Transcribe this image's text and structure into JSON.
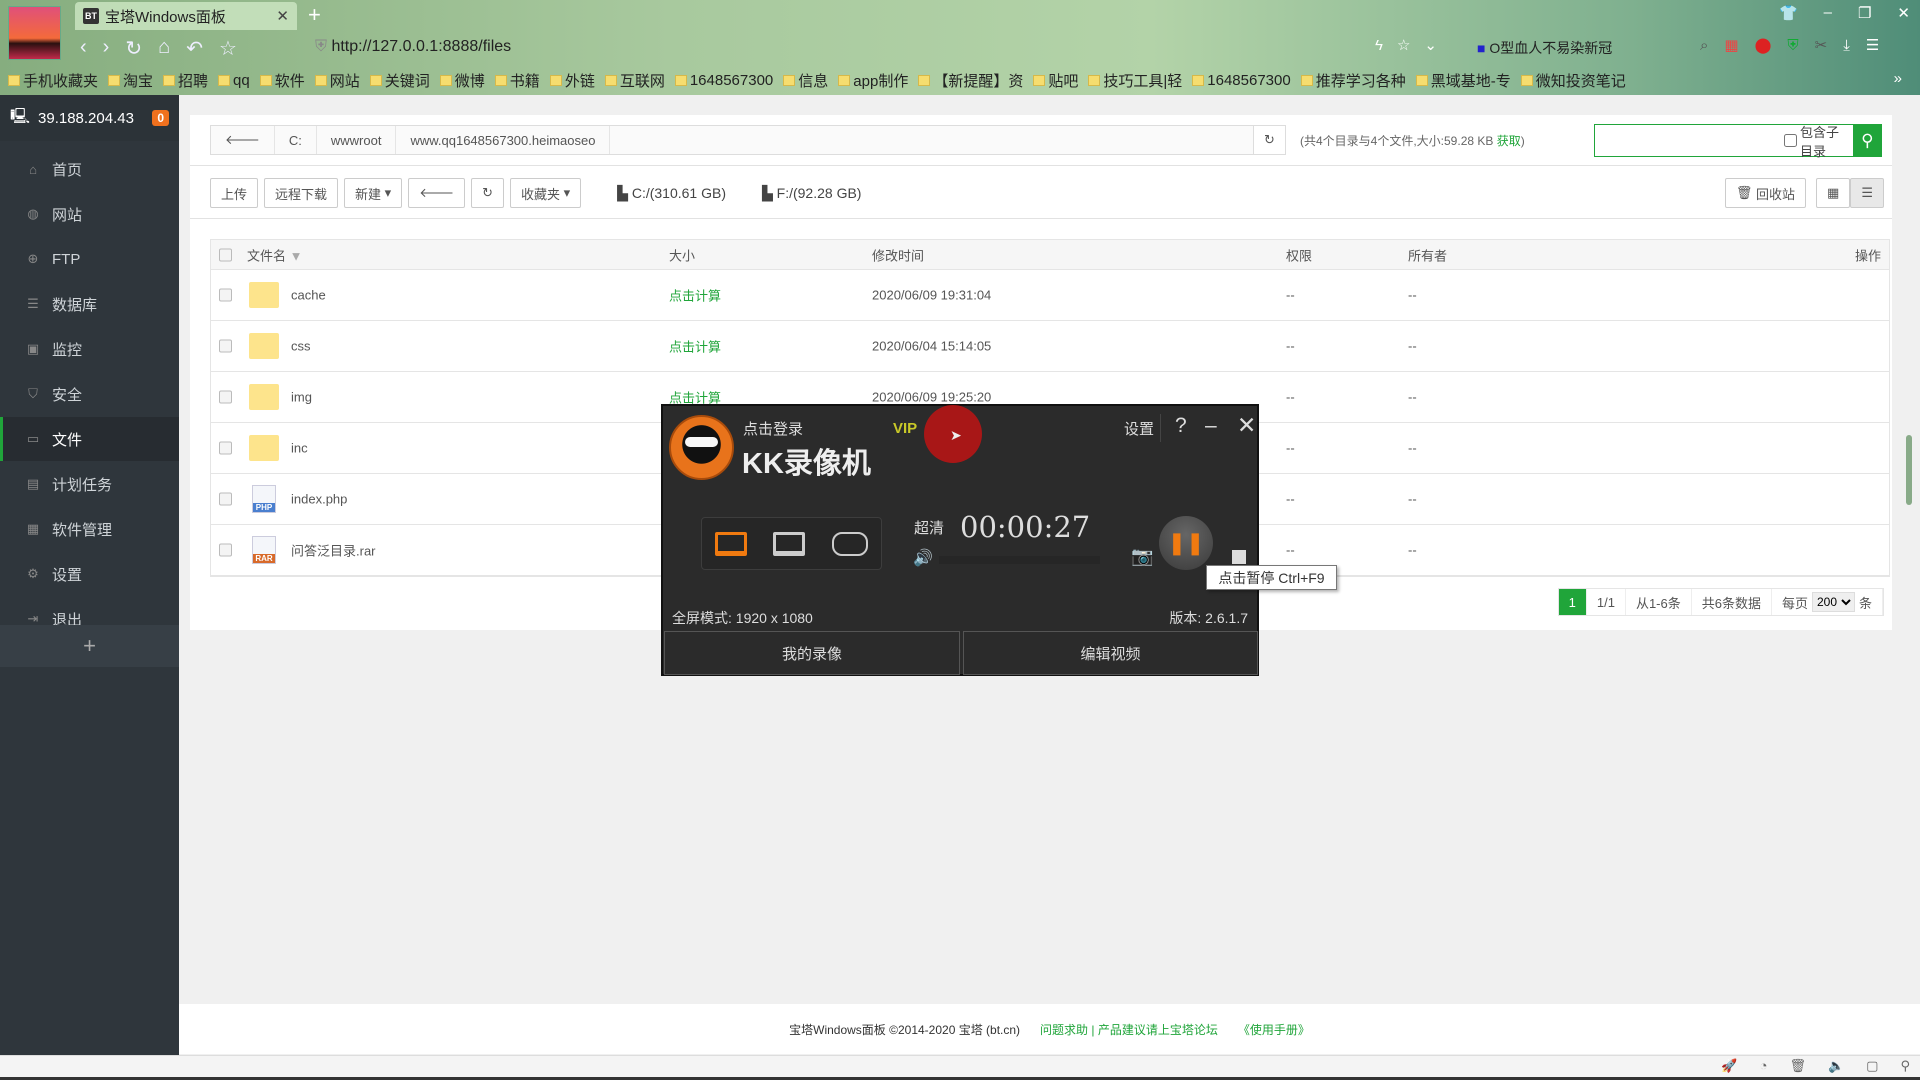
{
  "browser": {
    "tab_title": "宝塔Windows面板",
    "tab_icon": "BT",
    "url": "http://127.0.0.1:8888/files",
    "search_suggestion": "O型血人不易染新冠",
    "bookmarks": [
      "手机收藏夹",
      "淘宝",
      "招聘",
      "qq",
      "软件",
      "网站",
      "关键词",
      "微博",
      "书籍",
      "外链",
      "互联网",
      "1648567300",
      "信息",
      "app制作",
      "【新提醒】资",
      "贴吧",
      "技巧工具|轻",
      "1648567300",
      "推荐学习各种",
      "黑域基地-专",
      "微知投资笔记"
    ],
    "bookmarks_more": "»"
  },
  "sidebar": {
    "ip": "39.188.204.43",
    "badge": "0",
    "items": [
      {
        "label": "首页",
        "icon": "home-icon"
      },
      {
        "label": "网站",
        "icon": "globe-icon"
      },
      {
        "label": "FTP",
        "icon": "ftp-icon"
      },
      {
        "label": "数据库",
        "icon": "database-icon"
      },
      {
        "label": "监控",
        "icon": "monitor-icon"
      },
      {
        "label": "安全",
        "icon": "shield-icon"
      },
      {
        "label": "文件",
        "icon": "folder-icon",
        "active": true
      },
      {
        "label": "计划任务",
        "icon": "calendar-icon"
      },
      {
        "label": "软件管理",
        "icon": "apps-icon"
      },
      {
        "label": "设置",
        "icon": "gear-icon"
      },
      {
        "label": "退出",
        "icon": "logout-icon"
      }
    ],
    "add": "+"
  },
  "breadcrumb": [
    "C:",
    "wwwroot",
    "www.qq1648567300.heimaoseo"
  ],
  "info": {
    "text": "(共4个目录与4个文件,大小:59.28 KB ",
    "link": "获取",
    ")": ")"
  },
  "search": {
    "placeholder": "",
    "include_sub": "包含子目录"
  },
  "toolbar": {
    "upload": "上传",
    "remote_download": "远程下载",
    "new": "新建",
    "favorites": "收藏夹",
    "disk_c": "C:/(310.61 GB)",
    "disk_f": "F:/(92.28 GB)",
    "recycle": "回收站"
  },
  "table": {
    "headers": {
      "name": "文件名",
      "size": "大小",
      "time": "修改时间",
      "perm": "权限",
      "owner": "所有者",
      "op": "操作"
    },
    "rows": [
      {
        "name": "cache",
        "type": "folder",
        "size": "点击计算",
        "time": "2020/06/09 19:31:04",
        "perm": "--",
        "owner": "--"
      },
      {
        "name": "css",
        "type": "folder",
        "size": "点击计算",
        "time": "2020/06/04 15:14:05",
        "perm": "--",
        "owner": "--"
      },
      {
        "name": "img",
        "type": "folder",
        "size": "点击计算",
        "time": "2020/06/09 19:25:20",
        "perm": "--",
        "owner": "--"
      },
      {
        "name": "inc",
        "type": "folder",
        "size": "",
        "time": "",
        "perm": "--",
        "owner": "--"
      },
      {
        "name": "index.php",
        "type": "php",
        "size": "",
        "time": "",
        "perm": "--",
        "owner": "--"
      },
      {
        "name": "问答泛目录.rar",
        "type": "rar",
        "size": "",
        "time": "",
        "perm": "--",
        "owner": "--"
      }
    ]
  },
  "pager": {
    "current": "1",
    "pages": "1/1",
    "range": "从1-6条",
    "total": "共6条数据",
    "per_page_label": "每页",
    "per_page": "200",
    "unit": "条"
  },
  "footer": {
    "copyright": "宝塔Windows面板 ©2014-2020 宝塔 (bt.cn)",
    "help": "问题求助 | 产品建议请上宝塔论坛",
    "manual": "《使用手册》"
  },
  "kk": {
    "login": "点击登录",
    "vip": "VIP",
    "title": "KK录像机",
    "settings": "设置",
    "help": "?",
    "minimize": "–",
    "close": "✕",
    "quality": "超清",
    "timer": "00:00:27",
    "resolution": "全屏模式: 1920 x 1080",
    "version": "版本: 2.6.1.7",
    "my_recordings": "我的录像",
    "edit_video": "编辑视频",
    "tooltip": "点击暂停 Ctrl+F9",
    "recording_paused": false
  },
  "colors": {
    "accent": "#20a53a",
    "sidebar": "#2f363c",
    "kk_orange": "#f07a10"
  }
}
